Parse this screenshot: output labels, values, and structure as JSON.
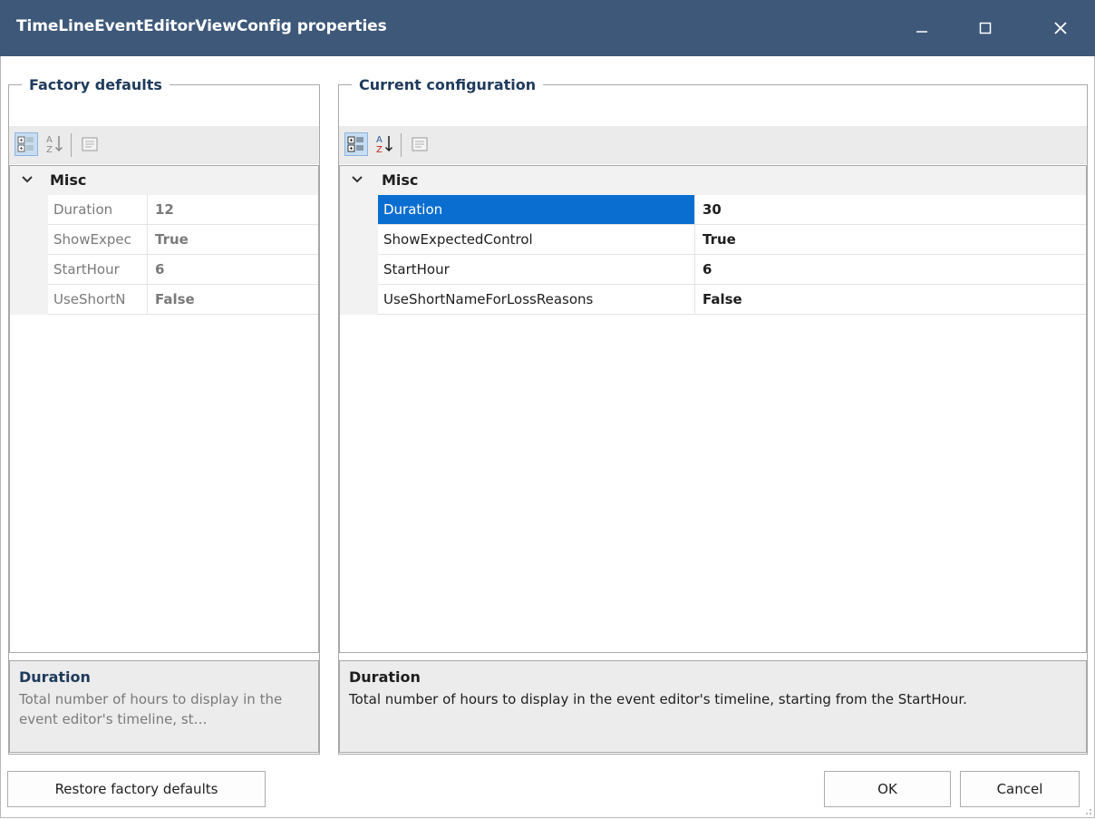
{
  "window": {
    "title": "TimeLineEventEditorViewConfig properties",
    "controls": [
      "minimize-icon",
      "maximize-icon",
      "close-icon"
    ]
  },
  "factory_defaults": {
    "legend": "Factory defaults",
    "toolbar": [
      "categorized-icon",
      "alphabetical-sort-icon",
      "property-pages-icon"
    ],
    "category": "Misc",
    "properties": [
      {
        "name": "Duration",
        "value": "12"
      },
      {
        "name": "ShowExpec",
        "value": "True"
      },
      {
        "name": "StartHour",
        "value": "6"
      },
      {
        "name": "UseShortN",
        "value": "False"
      }
    ],
    "description": {
      "title": "Duration",
      "text": "Total number of hours to display in the event editor's timeline, st…"
    }
  },
  "current_configuration": {
    "legend": "Current configuration",
    "toolbar": [
      "categorized-icon",
      "alphabetical-sort-icon",
      "property-pages-icon"
    ],
    "category": "Misc",
    "selected_property": "Duration",
    "properties": [
      {
        "name": "Duration",
        "value": "30"
      },
      {
        "name": "ShowExpectedControl",
        "value": "True"
      },
      {
        "name": "StartHour",
        "value": "6"
      },
      {
        "name": "UseShortNameForLossReasons",
        "value": "False"
      }
    ],
    "description": {
      "title": "Duration",
      "text": "Total number of hours to display in the event editor's timeline, starting from the StartHour."
    }
  },
  "buttons": {
    "restore": "Restore factory defaults",
    "ok": "OK",
    "cancel": "Cancel"
  },
  "colors": {
    "titlebar": "#3e5879",
    "selection": "#0a6ed1",
    "legend_text": "#1e3a5c"
  }
}
